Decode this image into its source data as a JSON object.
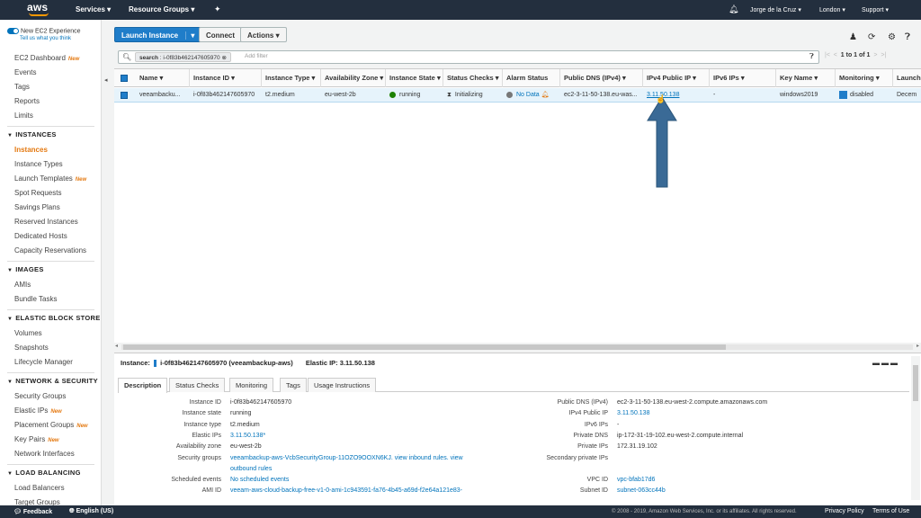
{
  "topnav": {
    "logo": "aws",
    "services": "Services",
    "resource_groups": "Resource Groups",
    "user": "Jorge de la Cruz",
    "region": "London",
    "support": "Support"
  },
  "sidebar": {
    "experience": "New EC2 Experience",
    "experience_link": "Tell us what you think",
    "new_badge": "New",
    "items": [
      {
        "label": "EC2 Dashboard",
        "new": true
      },
      {
        "label": "Events"
      },
      {
        "label": "Tags"
      },
      {
        "label": "Reports"
      },
      {
        "label": "Limits"
      }
    ],
    "sections": [
      {
        "title": "INSTANCES",
        "items": [
          "Instances",
          "Instance Types",
          "Launch Templates",
          "Spot Requests",
          "Savings Plans",
          "Reserved Instances",
          "Dedicated Hosts",
          "Capacity Reservations"
        ]
      },
      {
        "title": "IMAGES",
        "items": [
          "AMIs",
          "Bundle Tasks"
        ]
      },
      {
        "title": "ELASTIC BLOCK STORE",
        "items": [
          "Volumes",
          "Snapshots",
          "Lifecycle Manager"
        ]
      },
      {
        "title": "NETWORK & SECURITY",
        "items": [
          "Security Groups",
          "Elastic IPs",
          "Placement Groups",
          "Key Pairs",
          "Network Interfaces"
        ]
      },
      {
        "title": "LOAD BALANCING",
        "items": [
          "Load Balancers",
          "Target Groups"
        ]
      }
    ]
  },
  "toolbar": {
    "launch": "Launch Instance",
    "connect": "Connect",
    "actions": "Actions"
  },
  "filter": {
    "tag_key": "search",
    "tag_value": "i-0f83b462147605970",
    "placeholder": "Add filter",
    "pager": "1 to 1 of 1"
  },
  "table": {
    "headers": [
      "Name",
      "Instance ID",
      "Instance Type",
      "Availability Zone",
      "Instance State",
      "Status Checks",
      "Alarm Status",
      "Public DNS (IPv4)",
      "IPv4 Public IP",
      "IPv6 IPs",
      "Key Name",
      "Monitoring",
      "Launch"
    ],
    "row": {
      "name": "veeambacku...",
      "instance_id": "i-0f83b462147605970",
      "type": "t2.medium",
      "az": "eu-west-2b",
      "state": "running",
      "status": "Initializing",
      "alarm": "No Data",
      "dns": "ec2-3-11-50-138.eu-was...",
      "ipv4": "3.11.50.138",
      "ipv6": "-",
      "key": "windows2019",
      "monitoring": "disabled",
      "launch": "Decem"
    }
  },
  "details": {
    "header_label": "Instance:",
    "header_id": "i-0f83b462147605970 (veeambackup-aws)",
    "header_eip": "Elastic IP: 3.11.50.138",
    "tabs": [
      "Description",
      "Status Checks",
      "Monitoring",
      "Tags",
      "Usage Instructions"
    ],
    "left": [
      {
        "k": "Instance ID",
        "v": "i-0f83b462147605970"
      },
      {
        "k": "Instance state",
        "v": "running"
      },
      {
        "k": "Instance type",
        "v": "t2.medium"
      },
      {
        "k": "Elastic IPs",
        "v": "3.11.50.138*"
      },
      {
        "k": "Availability zone",
        "v": "eu-west-2b"
      },
      {
        "k": "Security groups",
        "v": "veeambackup-aws-VcbSecurityGroup-11OZO9OOXN6KJ. view inbound rules. view"
      },
      {
        "k": "",
        "v": "outbound rules"
      },
      {
        "k": "Scheduled events",
        "v": "No scheduled events"
      },
      {
        "k": "AMI ID",
        "v": "veeam-aws-cloud-backup-free-v1-0-ami-1c943591-fa76-4b45-a69d-f2e64a121e83-"
      }
    ],
    "right": [
      {
        "k": "Public DNS (IPv4)",
        "v": "ec2-3-11-50-138.eu-west-2.compute.amazonaws.com"
      },
      {
        "k": "IPv4 Public IP",
        "v": "3.11.50.138"
      },
      {
        "k": "IPv6 IPs",
        "v": "-"
      },
      {
        "k": "Private DNS",
        "v": "ip-172-31-19-102.eu-west-2.compute.internal"
      },
      {
        "k": "Private IPs",
        "v": "172.31.19.102"
      },
      {
        "k": "Secondary private IPs",
        "v": ""
      },
      {
        "k": "VPC ID",
        "v": "vpc-bfab17d6"
      },
      {
        "k": "Subnet ID",
        "v": "subnet-063cc44b"
      }
    ]
  },
  "footer": {
    "feedback": "Feedback",
    "language": "English (US)",
    "copyright": "© 2008 - 2019, Amazon Web Services, Inc. or its affiliates. All rights reserved.",
    "privacy": "Privacy Policy",
    "terms": "Terms of Use"
  },
  "colors": {
    "nav": "#232f3e",
    "accent": "#1f7dc9",
    "orange": "#e47911",
    "arrow": "#3a6a96"
  }
}
